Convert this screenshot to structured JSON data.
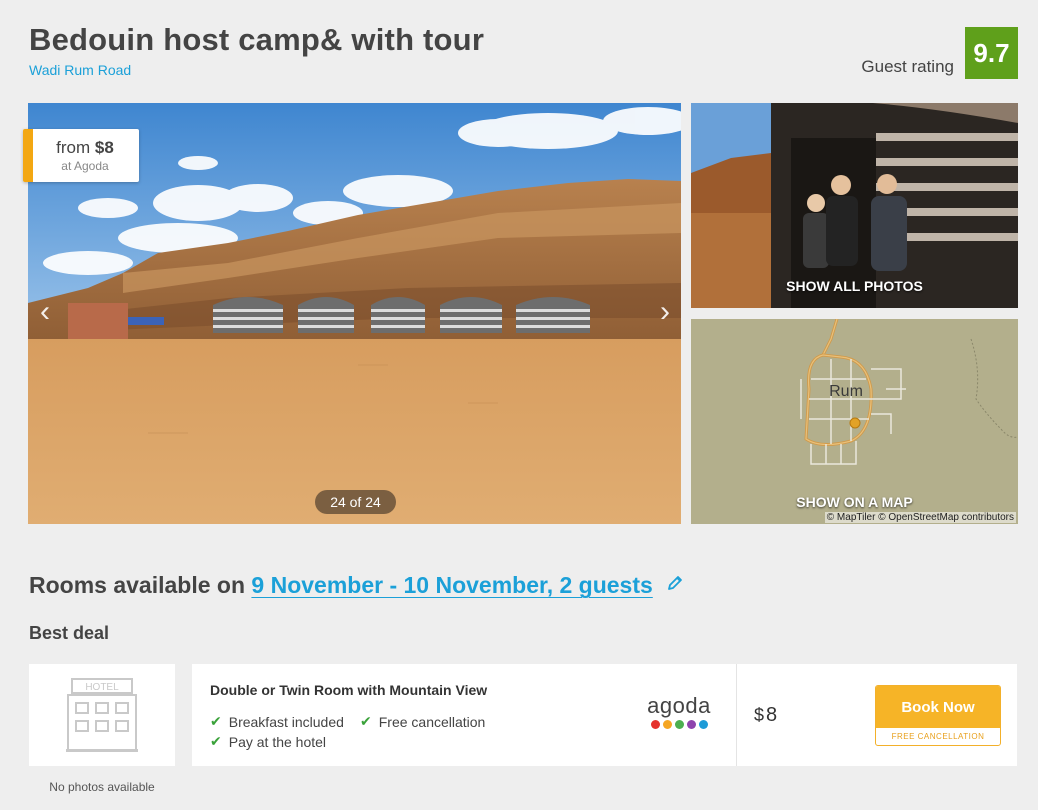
{
  "header": {
    "title": "Bedouin host camp& with tour",
    "address": "Wadi Rum Road",
    "rating_label": "Guest rating",
    "rating_value": "9.7"
  },
  "gallery": {
    "price_from_label": "from",
    "price_from_value": "$8",
    "price_source": "at Agoda",
    "prev_arrow": "‹",
    "next_arrow": "›",
    "counter": "24 of 24",
    "show_all_photos": "SHOW ALL PHOTOS",
    "map_place_label": "Rum",
    "show_on_map": "SHOW ON A MAP",
    "map_attribution": "© MapTiler © OpenStreetMap contributors"
  },
  "rooms": {
    "heading_prefix": "Rooms available on",
    "dates": "9 November - 10 November, 2 guests",
    "edit_icon": "pencil-icon",
    "best_deal_label": "Best deal",
    "no_photos": "No photos available",
    "thumb_sign": "HOTEL"
  },
  "deal": {
    "room_name": "Double or Twin Room with Mountain View",
    "amenities": [
      "Breakfast included",
      "Free cancellation",
      "Pay at the hotel"
    ],
    "provider": "agoda",
    "currency": "$",
    "price": "8",
    "book_label": "Book Now",
    "book_sub_label": "FREE CANCELLATION"
  },
  "colors": {
    "accent_blue": "#1ba0d8",
    "rating_green": "#5fa01b",
    "book_orange": "#f6b427",
    "check_green": "#3aa23a",
    "agoda_dots": [
      "#e5322d",
      "#f5a623",
      "#4caf50",
      "#8e44ad",
      "#1e9bd7"
    ]
  }
}
